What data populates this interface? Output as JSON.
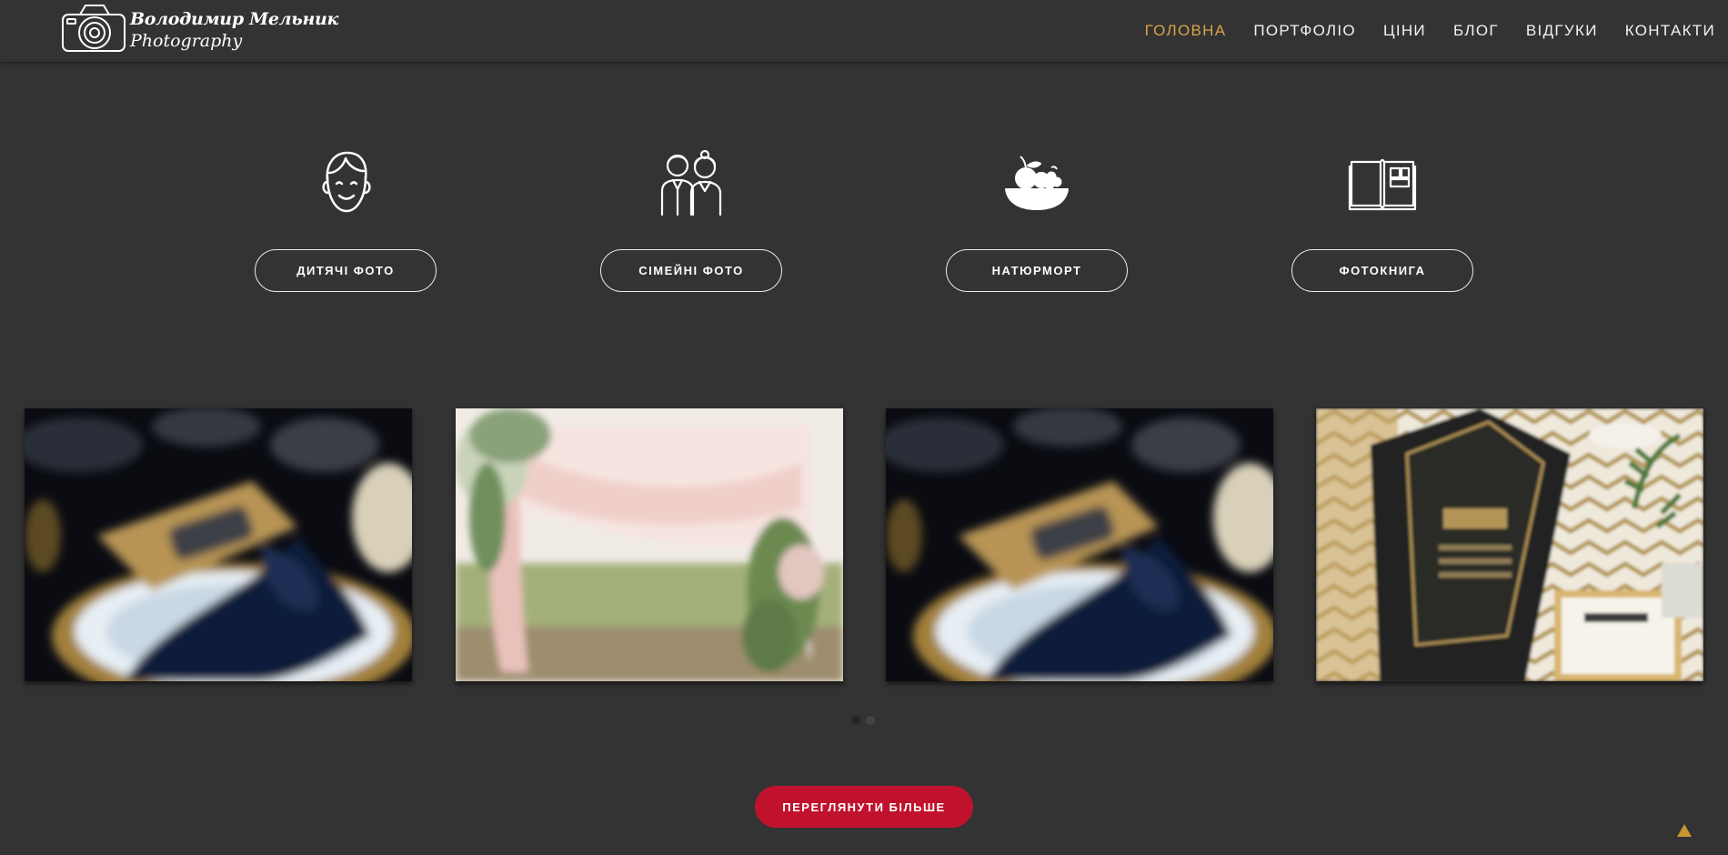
{
  "brand": {
    "name": "Володимир Мельник",
    "tagline": "Photography"
  },
  "nav": [
    {
      "label": "ГОЛОВНА",
      "active": true
    },
    {
      "label": "ПОРТФОЛІО",
      "active": false
    },
    {
      "label": "ЦІНИ",
      "active": false
    },
    {
      "label": "БЛОГ",
      "active": false
    },
    {
      "label": "ВІДГУКИ",
      "active": false
    },
    {
      "label": "КОНТАКТИ",
      "active": false
    }
  ],
  "services": [
    {
      "label": "ДИТЯЧІ ФОТО",
      "icon": "child-face-icon"
    },
    {
      "label": "СІМЕЙНІ ФОТО",
      "icon": "family-couple-icon"
    },
    {
      "label": "НАТЮРМОРТ",
      "icon": "fruit-bowl-icon"
    },
    {
      "label": "ФОТОКНИГА",
      "icon": "photobook-icon"
    }
  ],
  "gallery": [
    {
      "subject": "table-setting-napkin-photo"
    },
    {
      "subject": "wedding-arch-photo"
    },
    {
      "subject": "table-setting-napkin-photo"
    },
    {
      "subject": "art-deco-invitation-photo"
    }
  ],
  "carousel": {
    "pages": 2,
    "active_page": 1
  },
  "cta": {
    "label": "ПЕРЕГЛЯНУТИ БІЛЬШЕ"
  },
  "colors": {
    "background": "#333333",
    "nav_active": "#d9a34a",
    "cta": "#c0122c",
    "scroll_top": "#c9962f"
  }
}
